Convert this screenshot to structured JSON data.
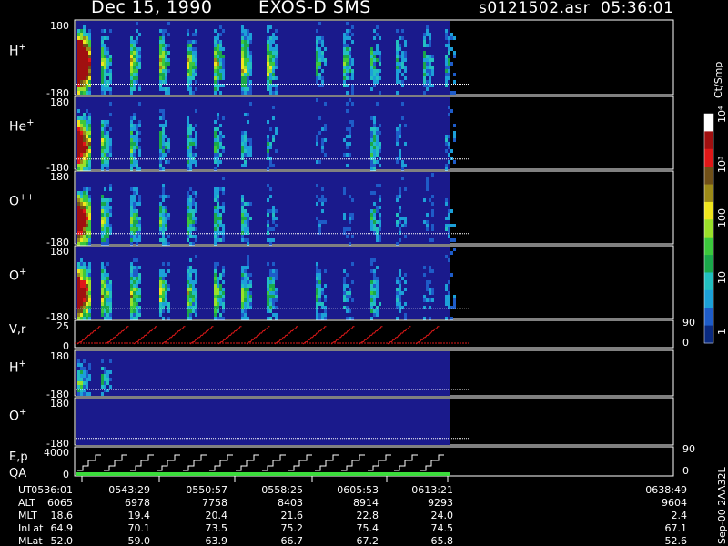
{
  "header": {
    "date": "Dec 15, 1990",
    "instrument": "EXOS-D SMS",
    "file_time": "s0121502.asr  05:36:01"
  },
  "colorbar": {
    "label": "Ct/Smp",
    "ticks": [
      "1",
      "10",
      "100",
      "10³",
      "10⁴"
    ],
    "colors": [
      "#0a2a80",
      "#1e5cc8",
      "#1ca0d8",
      "#22c0c0",
      "#1aa84a",
      "#3cc83c",
      "#9ae02a",
      "#f0e61e",
      "#9c8a18",
      "#705018",
      "#e01818",
      "#a01010",
      "#ffffff"
    ]
  },
  "chart_data": {
    "type": "heatmap",
    "title": "Dec 15, 1990   EXOS-D SMS",
    "time_range": [
      "05:36:01",
      "06:38:49"
    ],
    "data_end_time": "06:13:21",
    "panels": [
      {
        "name": "H+",
        "y_top": "180",
        "y_bottom": "-180",
        "kind": "spectrogram",
        "intensity": [
          3,
          0.8,
          0.9,
          0.9,
          0.9,
          0.9,
          1.0,
          0.9,
          0.5,
          0.6,
          0.5,
          0.4,
          0.5,
          0.4
        ]
      },
      {
        "name": "He+",
        "y_top": "180",
        "y_bottom": "-180",
        "kind": "spectrogram",
        "intensity": [
          2,
          0.7,
          0.6,
          0.5,
          0.5,
          0.5,
          0.4,
          0.3,
          0.1,
          0.1,
          0.5,
          0.2,
          0.0,
          0.2
        ]
      },
      {
        "name": "O++",
        "y_top": "180",
        "y_bottom": "-180",
        "kind": "spectrogram",
        "intensity": [
          2,
          0.8,
          0.7,
          0.6,
          0.6,
          0.6,
          0.5,
          0.3,
          0.1,
          0.1,
          0.5,
          0.2,
          0.1,
          0.2
        ]
      },
      {
        "name": "O+",
        "y_top": "180",
        "y_bottom": "-180",
        "kind": "spectrogram",
        "intensity": [
          2,
          0.9,
          0.9,
          0.8,
          0.8,
          0.8,
          0.7,
          0.6,
          0.5,
          0.3,
          0.5,
          0.3,
          0.2,
          0.2
        ]
      },
      {
        "name": "V,r",
        "y_top": "25",
        "y_bottom": "0",
        "right_top": "90",
        "right_bottom": "0",
        "kind": "line"
      },
      {
        "name": "H+",
        "y_top": "180",
        "y_bottom": "-180",
        "kind": "spectrogram",
        "intensity": [
          0.6,
          0.4,
          0.0,
          0.0,
          0.0,
          0.0,
          0.0,
          0.0,
          0.0,
          0.0,
          0.0,
          0.0,
          0.0,
          0.0
        ]
      },
      {
        "name": "O+",
        "y_top": "180",
        "y_bottom": "-180",
        "kind": "spectrogram",
        "intensity": [
          0,
          0,
          0,
          0,
          0,
          0,
          0,
          0,
          0,
          0,
          0,
          0,
          0,
          0
        ]
      },
      {
        "name": "E,p",
        "name2": "QA",
        "y_top": "4000",
        "y_bottom": "0",
        "right_top": "90",
        "right_bottom": "0",
        "kind": "steps"
      }
    ],
    "scan_count": 14,
    "time_table": {
      "rows": [
        "UT",
        "ALT",
        "MLT",
        "InLat",
        "MLat"
      ],
      "columns": [
        {
          "UT": "0536:01",
          "ALT": "6065",
          "MLT": "18.6",
          "InLat": "64.9",
          "MLat": "−52.0"
        },
        {
          "UT": "0543:29",
          "ALT": "6978",
          "MLT": "19.4",
          "InLat": "70.1",
          "MLat": "−59.0"
        },
        {
          "UT": "0550:57",
          "ALT": "7758",
          "MLT": "20.4",
          "InLat": "73.5",
          "MLat": "−63.9"
        },
        {
          "UT": "0558:25",
          "ALT": "8403",
          "MLT": "21.6",
          "InLat": "75.2",
          "MLat": "−66.7"
        },
        {
          "UT": "0605:53",
          "ALT": "8914",
          "MLT": "22.8",
          "InLat": "75.4",
          "MLat": "−67.2"
        },
        {
          "UT": "0613:21",
          "ALT": "9293",
          "MLT": "24.0",
          "InLat": "74.5",
          "MLat": "−65.8"
        },
        {
          "UT": "0638:49",
          "ALT": "9604",
          "MLT": "2.4",
          "InLat": "67.1",
          "MLat": "−52.6"
        }
      ]
    },
    "footer_note": "Sep-00  2AA32L"
  }
}
